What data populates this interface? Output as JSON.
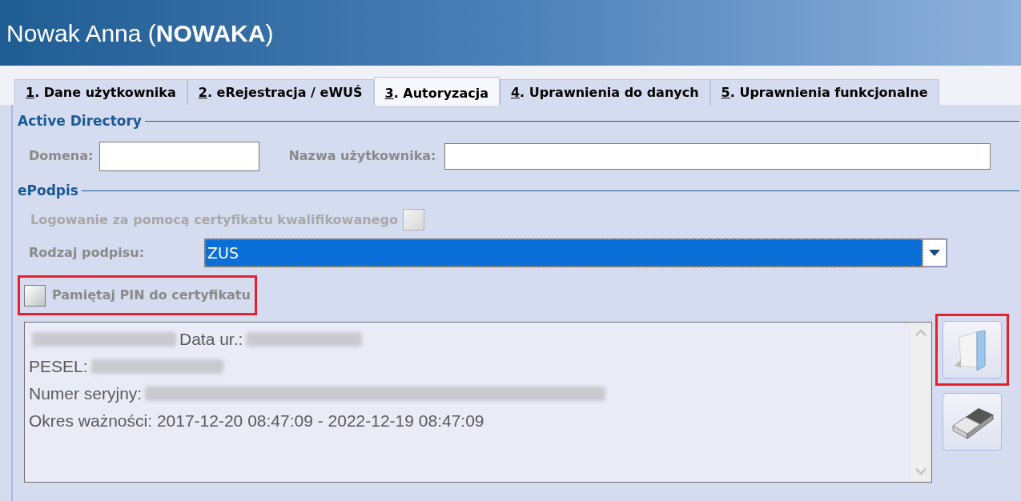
{
  "window": {
    "title": "Nowak Anna (**NOWAKA**)"
  },
  "tabs": [
    {
      "key": "1",
      "label": ". Dane użytkownika",
      "selected": false
    },
    {
      "key": "2",
      "label": ". eRejestracja / eWUŚ",
      "selected": false
    },
    {
      "key": "3",
      "label": ". Autoryzacja",
      "selected": true
    },
    {
      "key": "4",
      "label": ". Uprawnienia do danych",
      "selected": false
    },
    {
      "key": "5",
      "label": ". Uprawnienia funkcjonalne",
      "selected": false
    }
  ],
  "active_directory": {
    "legend": "Active Directory",
    "domain_label": "Domena:",
    "user_label": "Nazwa użytkownika:"
  },
  "epodpis": {
    "legend": "ePodpis",
    "cert_login": {
      "label": "Logowanie za pomocą certyfikatu kwalifikowanego",
      "checked": false,
      "disabled": true
    },
    "signature_type": {
      "label": "Rodzaj podpisu:",
      "value": "ZUS"
    },
    "remember_pin": {
      "label": "Pamiętaj PIN do certyfikatu",
      "checked": false,
      "highlighted": true
    }
  },
  "certificate_info": {
    "lines": [
      {
        "kind": "blurred_prefix",
        "label": "Data ur.:"
      },
      {
        "kind": "label_blurred",
        "label": "PESEL:"
      },
      {
        "kind": "label_blurred_long",
        "label": "Numer seryjny:"
      },
      {
        "kind": "text",
        "label": "Okres ważności: 2017-12-20 08:47:09 - 2022-12-19 08:47:09"
      }
    ]
  },
  "side_buttons": [
    {
      "kind": "folder",
      "highlighted": true
    },
    {
      "kind": "eraser",
      "highlighted": false
    }
  ]
}
